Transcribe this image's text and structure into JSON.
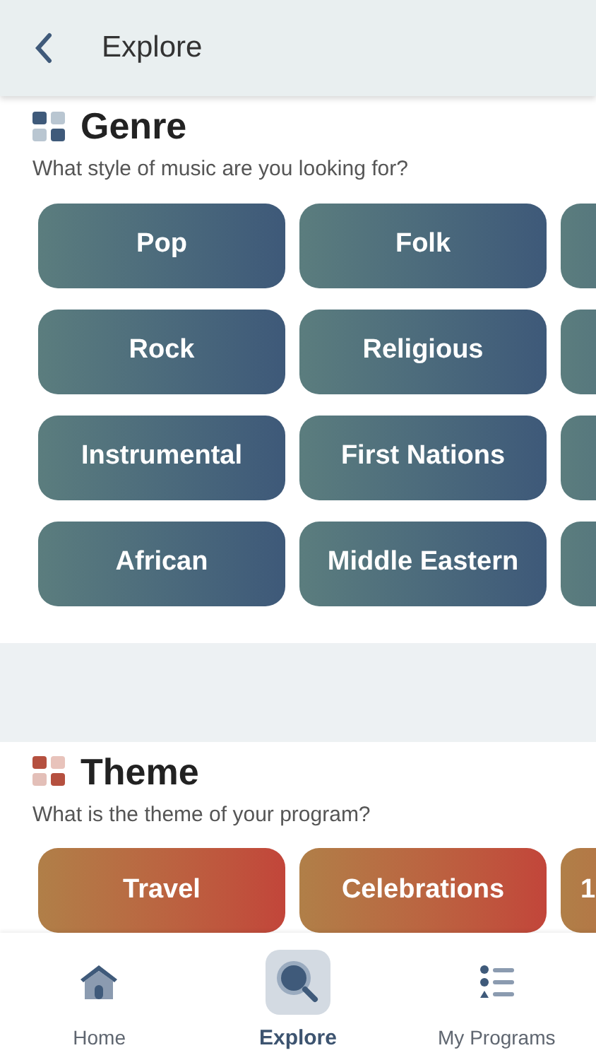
{
  "header": {
    "title": "Explore"
  },
  "sections": [
    {
      "kind": "genre",
      "title": "Genre",
      "subtitle": "What style of music are you looking for?",
      "rows": [
        {
          "items": [
            {
              "kind": "full",
              "label": "Pop"
            },
            {
              "kind": "full",
              "label": "Folk"
            },
            {
              "kind": "partial"
            }
          ]
        },
        {
          "items": [
            {
              "kind": "full",
              "label": "Rock"
            },
            {
              "kind": "full",
              "label": "Religious"
            },
            {
              "kind": "partial"
            }
          ]
        },
        {
          "items": [
            {
              "kind": "full",
              "label": "Instrumental"
            },
            {
              "kind": "full",
              "label": "First Nations"
            },
            {
              "kind": "partial"
            }
          ]
        },
        {
          "items": [
            {
              "kind": "full",
              "label": "African"
            },
            {
              "kind": "full",
              "label": "Middle Eastern"
            },
            {
              "kind": "partial"
            }
          ]
        }
      ]
    },
    {
      "kind": "theme",
      "title": "Theme",
      "subtitle": "What is the theme of your program?",
      "rows": [
        {
          "items": [
            {
              "kind": "full",
              "label": "Travel"
            },
            {
              "kind": "full",
              "label": "Celebrations"
            },
            {
              "kind": "partial",
              "label": "1"
            }
          ]
        }
      ]
    }
  ],
  "nav": [
    {
      "kind": "home",
      "label": "Home",
      "selected": false
    },
    {
      "kind": "explore",
      "label": "Explore",
      "selected": true
    },
    {
      "kind": "programs",
      "label": "My Programs",
      "selected": false
    }
  ]
}
